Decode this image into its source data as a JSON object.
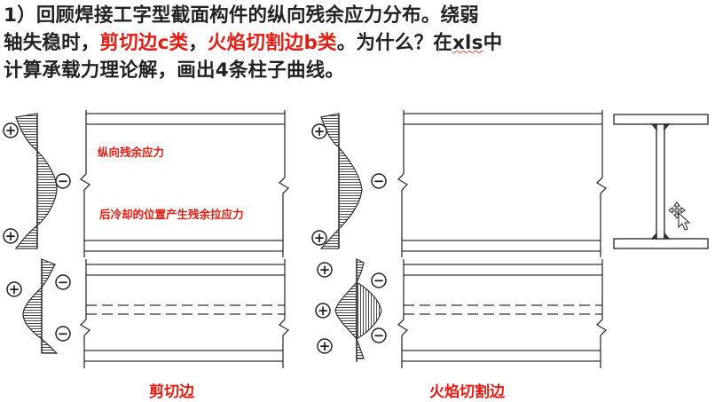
{
  "title": {
    "p1": "1）回顾焊接工字型截面构件的纵向残余应力分布。绕弱",
    "p2": "轴失稳时，",
    "hl1": "剪切边c类",
    "p3": "，",
    "hl2": "火焰切割边b类",
    "p4": "。为什么？在",
    "p5": "xls",
    "p6": "中",
    "p7": "计算承载力理论解，画出4条柱子曲线。"
  },
  "annotations": {
    "note1": "纵向残余应力",
    "note2": "后冷却的位置产生残余拉应力"
  },
  "captions": {
    "left": "剪切边",
    "right": "火焰切割边"
  },
  "signs": {
    "plus": "+",
    "minus": "−"
  },
  "colors": {
    "annotation": "#e41c12",
    "line": "#333333"
  }
}
